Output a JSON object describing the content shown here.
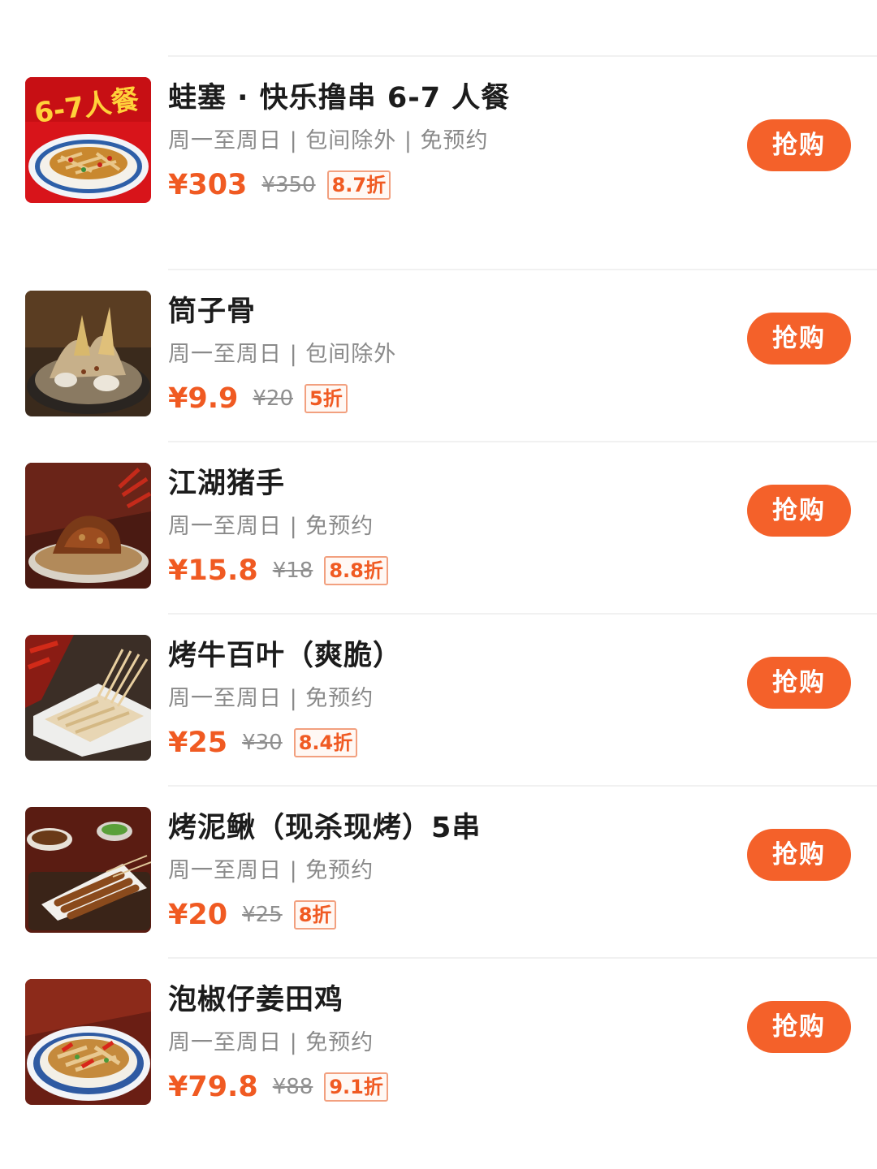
{
  "deals": [
    {
      "title": "蛙塞 · 快乐撸串 6-7 人餐",
      "subtitle": "周一至周日 | 包间除外 | 免预约",
      "price": "¥303",
      "original_price": "¥350",
      "discount": "8.7折",
      "button": "抢购",
      "image_label": "6-7人餐",
      "image_icon": "set-meal-image"
    },
    {
      "title": "筒子骨",
      "subtitle": "周一至周日 | 包间除外",
      "price": "¥9.9",
      "original_price": "¥20",
      "discount": "5折",
      "button": "抢购",
      "image_icon": "bone-broth-image"
    },
    {
      "title": "江湖猪手",
      "subtitle": "周一至周日 | 免预约",
      "price": "¥15.8",
      "original_price": "¥18",
      "discount": "8.8折",
      "button": "抢购",
      "image_icon": "pork-knuckle-image"
    },
    {
      "title": "烤牛百叶（爽脆）",
      "subtitle": "周一至周日 | 免预约",
      "price": "¥25",
      "original_price": "¥30",
      "discount": "8.4折",
      "button": "抢购",
      "image_icon": "tripe-skewer-image"
    },
    {
      "title": "烤泥鳅（现杀现烤）5串",
      "subtitle": "周一至周日 | 免预约",
      "price": "¥20",
      "original_price": "¥25",
      "discount": "8折",
      "button": "抢购",
      "image_icon": "loach-skewer-image"
    },
    {
      "title": "泡椒仔姜田鸡",
      "subtitle": "周一至周日 | 免预约",
      "price": "¥79.8",
      "original_price": "¥88",
      "discount": "9.1折",
      "button": "抢购",
      "image_icon": "pickled-pepper-frog-image"
    }
  ],
  "colors": {
    "accent": "#f4612a",
    "price": "#f05a22",
    "title": "#1c1c1c",
    "subtitle": "#8a8a8a",
    "divider": "#f1f1f1"
  }
}
